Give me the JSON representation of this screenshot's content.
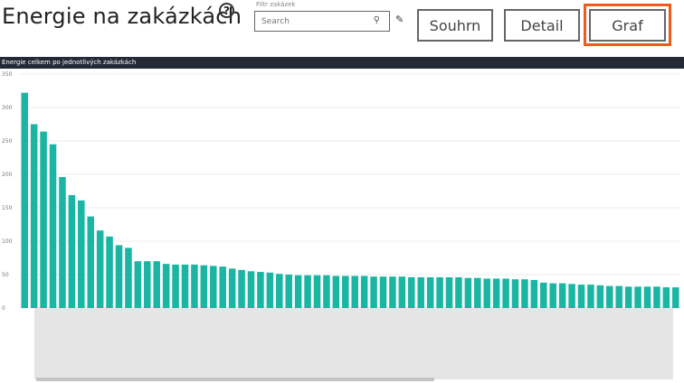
{
  "header": {
    "title": "Energie na zakázkách",
    "help_glyph": "?",
    "filter_label": "Filtr zakázek",
    "search_placeholder": "Search",
    "buttons": {
      "souhrn": "Souhrn",
      "detail": "Detail",
      "graf": "Graf"
    },
    "active_button": "Graf",
    "accent": "#f05a1e"
  },
  "chart_data": {
    "type": "bar",
    "title": "Energie celkem po jednotlivých zakázkách",
    "color": "#1ab5a3",
    "ylim": [
      0,
      350
    ],
    "yticks": [
      0,
      50,
      100,
      150,
      200,
      250,
      300,
      350
    ],
    "grid": true,
    "values": [
      322,
      275,
      264,
      245,
      196,
      169,
      161,
      137,
      116,
      107,
      94,
      90,
      70,
      70,
      70,
      66,
      65,
      65,
      65,
      64,
      63,
      62,
      59,
      57,
      55,
      54,
      53,
      51,
      50,
      49,
      49,
      49,
      49,
      48,
      48,
      48,
      48,
      47,
      47,
      47,
      47,
      46,
      46,
      46,
      46,
      46,
      46,
      45,
      45,
      44,
      44,
      44,
      43,
      43,
      42,
      38,
      37,
      37,
      36,
      35,
      35,
      34,
      33,
      33,
      32,
      32,
      32,
      32,
      31,
      31
    ]
  }
}
